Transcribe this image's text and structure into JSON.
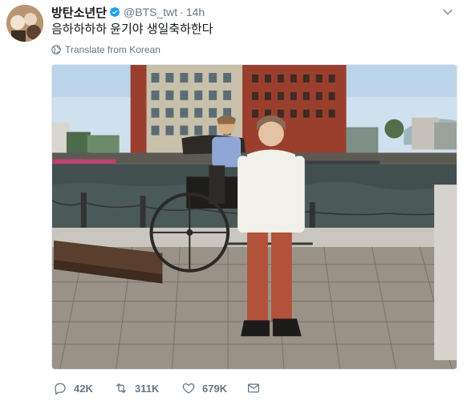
{
  "tweet": {
    "author_name": "방탄소년단",
    "handle": "@BTS_twt",
    "separator": "·",
    "time": "14h",
    "text": "음하하하하 윤기야 생일축하한다",
    "translate_label": "Translate from Korean"
  },
  "icons": {
    "verified": "verified-badge-icon",
    "caret": "chevron-down-icon",
    "globe": "globe-icon",
    "reply": "reply-icon",
    "retweet": "retweet-icon",
    "like": "heart-icon",
    "dm": "direct-message-icon"
  },
  "actions": {
    "reply_count": "42K",
    "retweet_count": "311K",
    "like_count": "679K"
  },
  "colors": {
    "verified": "#1da1f2",
    "text": "#14171a",
    "muted": "#657786"
  }
}
